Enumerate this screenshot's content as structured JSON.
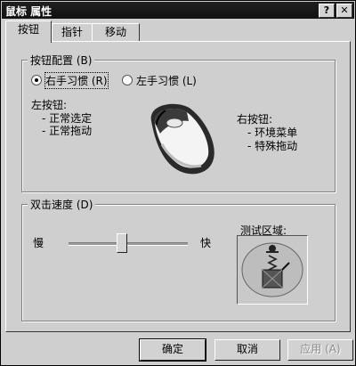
{
  "window": {
    "title": "鼠标 属性",
    "help_glyph": "?",
    "close_glyph": "✕"
  },
  "tabs": [
    {
      "label": "按钮"
    },
    {
      "label": "指针"
    },
    {
      "label": "移动"
    }
  ],
  "button_config": {
    "group_label": "按钮配置 (B)",
    "right_handed_label": "右手习惯 (R)",
    "left_handed_label": "左手习惯 (L)",
    "selected": "右手习惯 (R)",
    "left_button_title": "左按钮:",
    "left_button_items": [
      "- 正常选定",
      "- 正常拖动"
    ],
    "right_button_title": "右按钮:",
    "right_button_items": [
      "- 环境菜单",
      "- 特殊拖动"
    ]
  },
  "double_click": {
    "group_label": "双击速度 (D)",
    "slow_label": "慢",
    "fast_label": "快",
    "speed_value": 0.45,
    "test_area_label": "测试区域:"
  },
  "buttons": {
    "ok": "确定",
    "cancel": "取消",
    "apply": "应用 (A)"
  }
}
